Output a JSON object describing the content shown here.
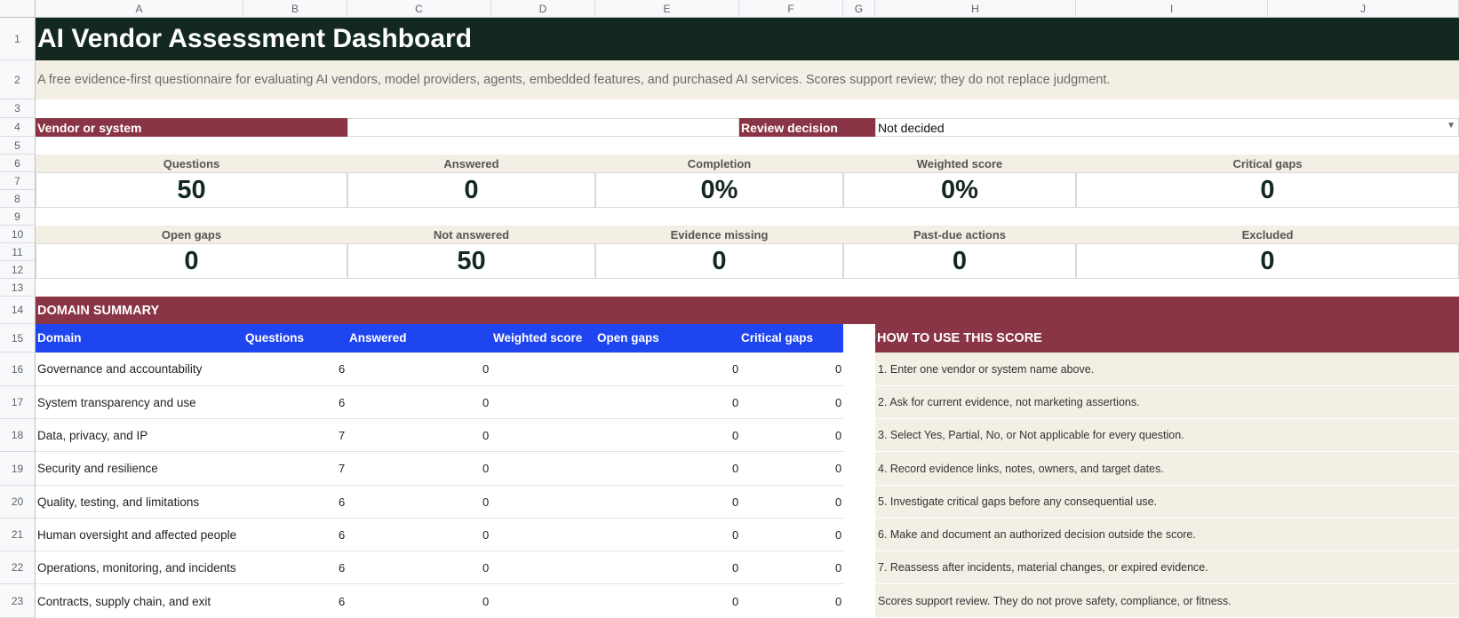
{
  "columns": [
    "A",
    "B",
    "C",
    "D",
    "E",
    "F",
    "G",
    "H",
    "I",
    "J"
  ],
  "rows": [
    "1",
    "2",
    "3",
    "4",
    "5",
    "6",
    "7",
    "8",
    "9",
    "10",
    "11",
    "12",
    "13",
    "14",
    "15",
    "16",
    "17",
    "18",
    "19",
    "20",
    "21",
    "22",
    "23"
  ],
  "title": "AI Vendor Assessment Dashboard",
  "subtitle": "A free evidence-first questionnaire for evaluating AI vendors, model providers, agents, embedded features, and purchased AI services. Scores support review; they do not replace judgment.",
  "vendor_label": "Vendor or system",
  "vendor_value": "",
  "review_label": "Review decision",
  "review_value": "Not decided",
  "kpi_row1": [
    {
      "label": "Questions",
      "value": "50"
    },
    {
      "label": "Answered",
      "value": "0"
    },
    {
      "label": "Completion",
      "value": "0%"
    },
    {
      "label": "Weighted score",
      "value": "0%"
    },
    {
      "label": "Critical gaps",
      "value": "0"
    }
  ],
  "kpi_row2": [
    {
      "label": "Open gaps",
      "value": "0"
    },
    {
      "label": "Not answered",
      "value": "50"
    },
    {
      "label": "Evidence missing",
      "value": "0"
    },
    {
      "label": "Past-due actions",
      "value": "0"
    },
    {
      "label": "Excluded",
      "value": "0"
    }
  ],
  "domain_summary_title": "DOMAIN SUMMARY",
  "table_headers": [
    "Domain",
    "Questions",
    "Answered",
    "Weighted score",
    "Open gaps",
    "Critical gaps"
  ],
  "domains": [
    {
      "name": "Governance and accountability",
      "questions": "6",
      "answered": "0",
      "weighted": "",
      "open": "0",
      "critical": "0"
    },
    {
      "name": "System transparency and use",
      "questions": "6",
      "answered": "0",
      "weighted": "",
      "open": "0",
      "critical": "0"
    },
    {
      "name": "Data, privacy, and IP",
      "questions": "7",
      "answered": "0",
      "weighted": "",
      "open": "0",
      "critical": "0"
    },
    {
      "name": "Security and resilience",
      "questions": "7",
      "answered": "0",
      "weighted": "",
      "open": "0",
      "critical": "0"
    },
    {
      "name": "Quality, testing, and limitations",
      "questions": "6",
      "answered": "0",
      "weighted": "",
      "open": "0",
      "critical": "0"
    },
    {
      "name": "Human oversight and affected people",
      "questions": "6",
      "answered": "0",
      "weighted": "",
      "open": "0",
      "critical": "0"
    },
    {
      "name": "Operations, monitoring, and incidents",
      "questions": "6",
      "answered": "0",
      "weighted": "",
      "open": "0",
      "critical": "0"
    },
    {
      "name": "Contracts, supply chain, and exit",
      "questions": "6",
      "answered": "0",
      "weighted": "",
      "open": "0",
      "critical": "0"
    }
  ],
  "howto_title": "HOW TO USE THIS SCORE",
  "howto": [
    "1. Enter one vendor or system name above.",
    "2. Ask for current evidence, not marketing assertions.",
    "3. Select Yes, Partial, No, or Not applicable for every question.",
    "4. Record evidence links, notes, owners, and target dates.",
    "5. Investigate critical gaps before any consequential use.",
    "6. Make and document an authorized decision outside the score.",
    "7. Reassess after incidents, material changes, or expired evidence.",
    "Scores support review. They do not prove safety, compliance, or fitness."
  ],
  "colors": {
    "title_bg": "#13291f",
    "maroon": "#8a3545",
    "blue": "#1f45f0",
    "cream": "#f4efe4"
  }
}
